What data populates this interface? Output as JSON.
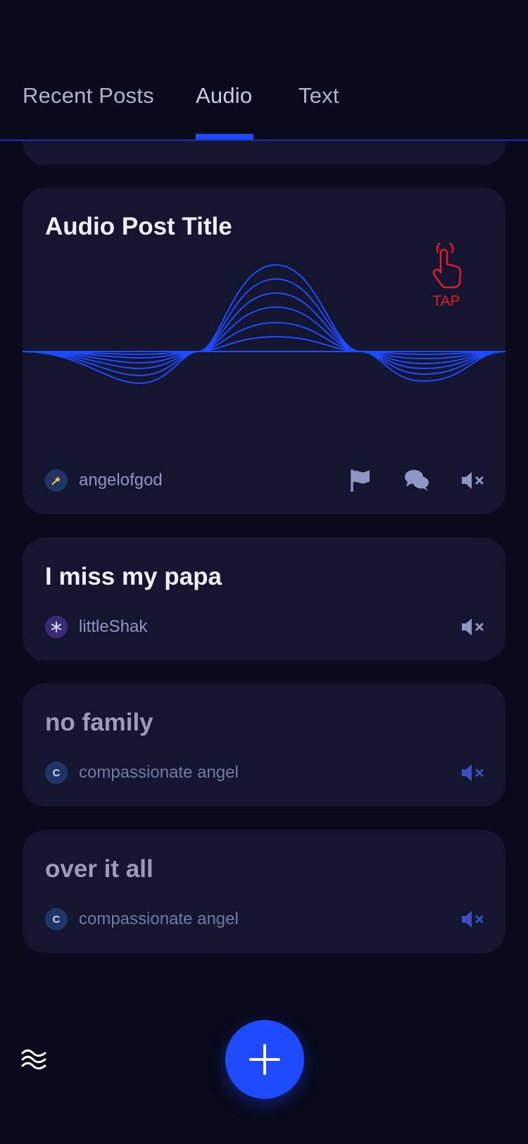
{
  "tabs": [
    {
      "label": "Recent Posts",
      "active": false
    },
    {
      "label": "Audio",
      "active": true
    },
    {
      "label": "Text",
      "active": false
    }
  ],
  "featured_post": {
    "title": "Audio Post Title",
    "tap_hint": "TAP",
    "author": {
      "name": "angelofgod",
      "avatar_icon": "shooting-star-icon"
    },
    "actions": [
      "flag-icon",
      "comment-icon",
      "mute-icon"
    ]
  },
  "posts": [
    {
      "title": "I miss my papa",
      "author": {
        "name": "littleShak",
        "avatar_icon": "snowflake-icon"
      }
    },
    {
      "title": "no family",
      "author": {
        "name": "compassionate angel",
        "avatar_initial": "C"
      }
    },
    {
      "title": "over it all",
      "author": {
        "name": "compassionate angel",
        "avatar_initial": "C"
      }
    }
  ],
  "colors": {
    "background": "#090a1c",
    "card": "#14152f",
    "accent": "#1e4bff",
    "tap_hint": "#e21a2b"
  },
  "fab": {
    "icon": "plus-icon"
  },
  "bottom_left": {
    "icon": "waves-menu-icon"
  }
}
